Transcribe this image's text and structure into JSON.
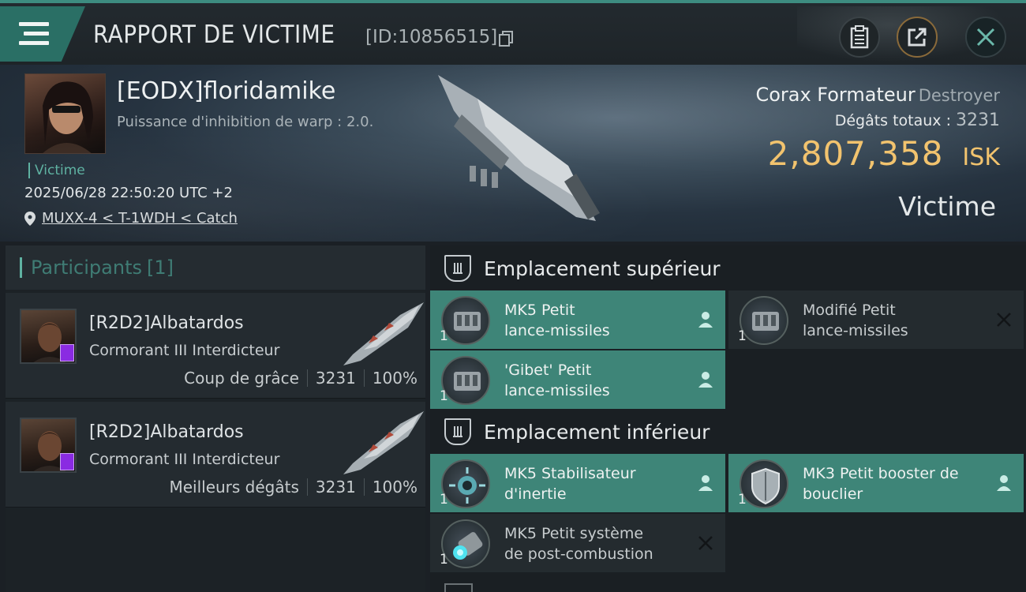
{
  "header": {
    "title": "RAPPORT DE VICTIME",
    "id": "[ID:10856515]",
    "icons": [
      "menu-icon",
      "copy-icon",
      "clipboard-icon",
      "share-icon",
      "close-icon"
    ]
  },
  "victim": {
    "name": "[EODX]floridamike",
    "warp_text": "Puissance d'inhibition de warp : 2.0.",
    "tag": "Victime",
    "datetime": "2025/06/28 22:50:20 UTC +2",
    "location": "MUXX-4 < T-1WDH < Catch",
    "ship_name": "Corax Formateur",
    "ship_class": "Destroyer",
    "damage_label": "Dégâts totaux :",
    "damage_value": "3231",
    "isk_amount": "2,807,358",
    "isk_unit": "ISK",
    "role_label": "Victime"
  },
  "participants": {
    "label": "Participants",
    "count": "[1]",
    "rows": [
      {
        "name": "[R2D2]Albatardos",
        "ship": "Cormorant III Interdicteur",
        "role": "Coup de grâce",
        "damage": "3231",
        "percent": "100%"
      },
      {
        "name": "[R2D2]Albatardos",
        "ship": "Cormorant III Interdicteur",
        "role": "Meilleurs dégâts",
        "damage": "3231",
        "percent": "100%"
      }
    ]
  },
  "slots": {
    "high": {
      "title": "Emplacement supérieur",
      "modules": [
        {
          "line1": "MK5 Petit",
          "line2": "lance-missiles",
          "qty": "1",
          "state": "dropped"
        },
        {
          "line1": "Modifié Petit",
          "line2": "lance-missiles",
          "qty": "1",
          "state": "destroyed"
        },
        {
          "line1": "'Gibet' Petit",
          "line2": "lance-missiles",
          "qty": "1",
          "state": "dropped"
        }
      ]
    },
    "low": {
      "title": "Emplacement inférieur",
      "modules": [
        {
          "line1": "MK5 Stabilisateur",
          "line2": "d'inertie",
          "qty": "1",
          "state": "dropped"
        },
        {
          "line1": "MK3 Petit booster de",
          "line2": "bouclier",
          "qty": "1",
          "state": "dropped"
        },
        {
          "line1": "MK5 Petit système",
          "line2": "de post-combustion",
          "qty": "1",
          "state": "destroyed"
        }
      ]
    }
  },
  "colors": {
    "accent": "#3e8578",
    "isk": "#f2c36e",
    "teal_text": "#5fb2a2"
  }
}
